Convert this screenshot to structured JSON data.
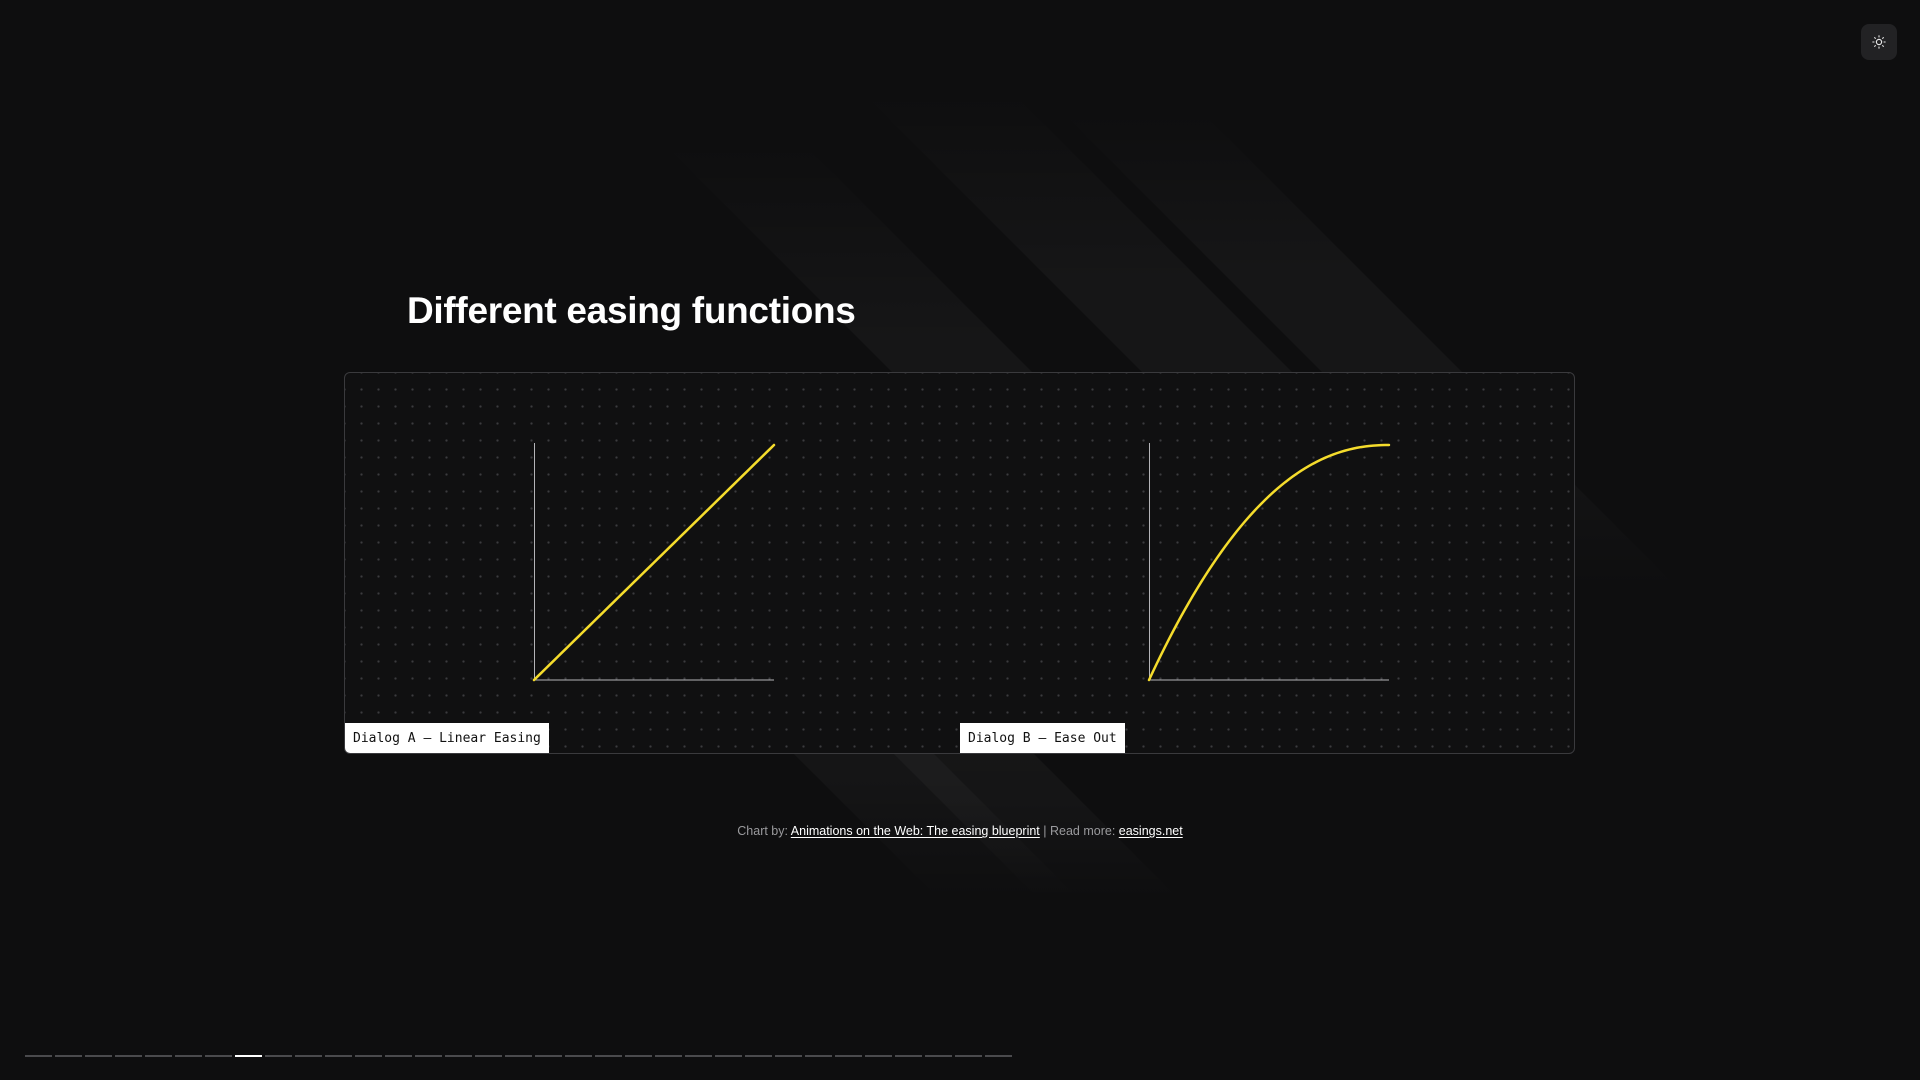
{
  "theme_toggle": {
    "icon": "sun-icon"
  },
  "slide": {
    "title": "Different easing functions",
    "panel": {
      "graphs": [
        {
          "label": "Dialog A – Linear Easing",
          "easing": "linear"
        },
        {
          "label": "Dialog B – Ease Out",
          "easing": "ease-out"
        }
      ],
      "curve_color": "#f5dc2c",
      "axis_color": "#b4b4b8"
    },
    "credits": {
      "prefix": "Chart by:",
      "source_link": "Animations on the Web: The easing blueprint",
      "separator": "| Read more:",
      "more_link": "easings.net"
    }
  },
  "progress": {
    "total": 33,
    "current": 8
  }
}
